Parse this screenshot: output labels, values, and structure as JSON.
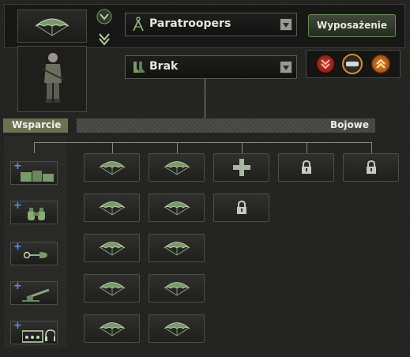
{
  "header": {
    "unit_icon": "parachute-icon",
    "template_name": "Paratroopers",
    "equipment_button": "Wyposażenie",
    "subunit_name": "Brak"
  },
  "sections": {
    "support_label": "Wsparcie",
    "combat_label": "Bojowe"
  },
  "support_slots": [
    {
      "icon": "engineer-crates-icon"
    },
    {
      "icon": "binoculars-recon-icon"
    },
    {
      "icon": "military-police-icon"
    },
    {
      "icon": "artillery-gun-icon"
    },
    {
      "icon": "radio-signal-icon"
    }
  ],
  "combat_columns": [
    [
      "parachute",
      "parachute",
      "parachute",
      "parachute",
      "parachute"
    ],
    [
      "parachute",
      "parachute",
      "parachute",
      "parachute",
      "parachute"
    ],
    [
      "add",
      "locked"
    ],
    [
      "locked"
    ],
    [
      "locked"
    ]
  ],
  "colors": {
    "accent_green": "#7a9a6a",
    "support_bar": "#6b7254",
    "plus_blue": "#5d8cff"
  }
}
